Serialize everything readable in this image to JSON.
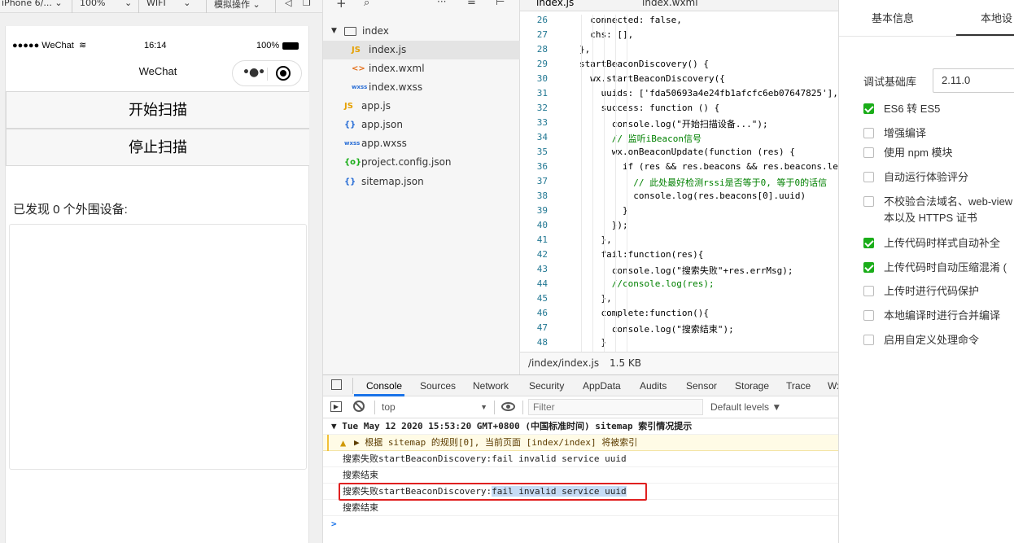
{
  "device_toolbar": {
    "device": "iPhone 6/...",
    "zoom": "100%",
    "network": "WIFI",
    "simulate": "模拟操作"
  },
  "phone": {
    "carrier": "●●●●● WeChat",
    "time": "16:14",
    "battery": "100%",
    "nav_title": "WeChat",
    "start_button": "开始扫描",
    "stop_button": "停止扫描",
    "found_text": "已发现 0 个外围设备:"
  },
  "file_tree": {
    "folder": "index",
    "files": [
      {
        "icon": "JS",
        "name": "index.js",
        "selected": true,
        "indent": 1
      },
      {
        "icon": "<>",
        "name": "index.wxml",
        "indent": 1
      },
      {
        "icon": "wxss",
        "name": "index.wxss",
        "indent": 1
      },
      {
        "icon": "JS",
        "name": "app.js",
        "indent": 0
      },
      {
        "icon": "{}",
        "name": "app.json",
        "indent": 0
      },
      {
        "icon": "wxss",
        "name": "app.wxss",
        "indent": 0
      },
      {
        "icon": "{o}",
        "name": "project.config.json",
        "indent": 0
      },
      {
        "icon": "{}",
        "name": "sitemap.json",
        "indent": 0
      }
    ]
  },
  "editor": {
    "tabs": [
      "index.js",
      "index.wxml"
    ],
    "line_numbers": [
      "26",
      "27",
      "28",
      "29",
      "30",
      "31",
      "32",
      "33",
      "34",
      "35",
      "36",
      "37",
      "38",
      "39",
      "40",
      "41",
      "42",
      "43",
      "44",
      "45",
      "46",
      "47",
      "48"
    ],
    "lines": [
      "  connected: false,",
      "  chs: [],",
      "},",
      "startBeaconDiscovery() {",
      "  wx.startBeaconDiscovery({",
      "    uuids: ['fda50693a4e24fb1afcfc6eb07647825'],",
      "    success: function () {",
      "      console.log(\"开始扫描设备...\");",
      "      // 监听iBeacon信号",
      "      wx.onBeaconUpdate(function (res) {",
      "        if (res && res.beacons && res.beacons.le",
      "          // 此处最好检测rssi是否等于0, 等于0的话信",
      "          console.log(res.beacons[0].uuid)",
      "        }",
      "      });",
      "    },",
      "    fail:function(res){",
      "      console.log(\"搜索失败\"+res.errMsg);",
      "      //console.log(res);",
      "    },",
      "    complete:function(){",
      "      console.log(\"搜索结束\");",
      "    }"
    ],
    "file_path": "/index/index.js",
    "file_size": "1.5 KB"
  },
  "devtools": {
    "tabs": [
      "Console",
      "Sources",
      "Network",
      "Security",
      "AppData",
      "Audits",
      "Sensor",
      "Storage",
      "Trace",
      "Wx"
    ],
    "context": "top",
    "filter_placeholder": "Filter",
    "levels": "Default levels ▼",
    "group_header": "▼ Tue May 12 2020 15:53:20 GMT+0800 (中国标准时间) sitemap 索引情况提示",
    "warning": "▶ 根据 sitemap 的规则[0], 当前页面 [index/index] 将被索引",
    "logs": [
      "搜索失败startBeaconDiscovery:fail invalid service uuid",
      "搜索结束",
      "搜索结束"
    ],
    "highlight_prefix": "搜索失败startBeaconDiscovery:",
    "highlight_selected": "fail invalid service uuid",
    "prompt": ">"
  },
  "settings": {
    "tabs": [
      "基本信息",
      "本地设"
    ],
    "lib_label": "调试基础库",
    "lib_version": "2.11.0",
    "options": [
      {
        "label": "ES6 转 ES5",
        "checked": true
      },
      {
        "label": "增强编译",
        "checked": false
      },
      {
        "label": "使用 npm 模块",
        "checked": false
      },
      {
        "label": "自动运行体验评分",
        "checked": false
      },
      {
        "label": "不校验合法域名、web-view",
        "label2": "本以及 HTTPS 证书",
        "checked": false
      },
      {
        "label": "上传代码时样式自动补全",
        "checked": true
      },
      {
        "label": "上传代码时自动压缩混淆 (",
        "checked": true
      },
      {
        "label": "上传时进行代码保护",
        "checked": false
      },
      {
        "label": "本地编译时进行合并编译",
        "checked": false
      },
      {
        "label": "启用自定义处理命令",
        "checked": false
      }
    ],
    "colors": {
      "check": "#1aad19",
      "highlight_border": "#e02020",
      "selection": "#c6dcf5"
    }
  }
}
